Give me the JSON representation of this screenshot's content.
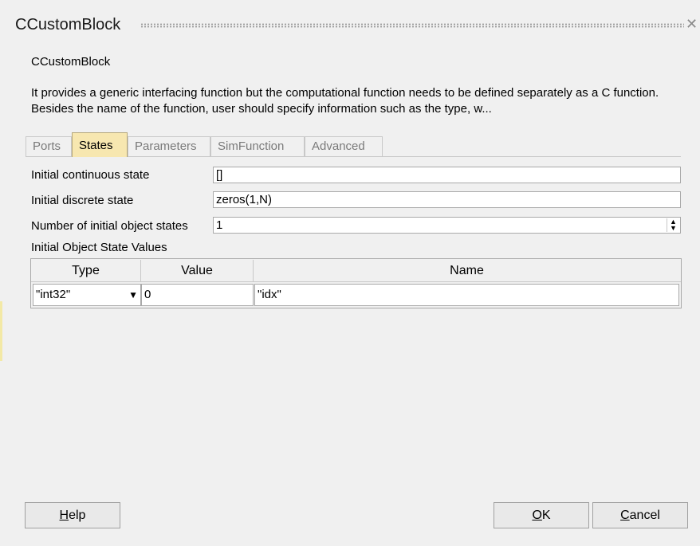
{
  "window": {
    "title": "CCustomBlock"
  },
  "block_name": "CCustomBlock",
  "description": "It provides a generic interfacing function but the computational function needs to be defined separately as a C function. Besides the name of the function, user should specify information such as the type, w...",
  "tabs": [
    {
      "label": "Ports",
      "active": false
    },
    {
      "label": "States",
      "active": true
    },
    {
      "label": "Parameters",
      "active": false
    },
    {
      "label": "SimFunction",
      "active": false
    },
    {
      "label": "Advanced",
      "active": false
    }
  ],
  "states": {
    "initial_continuous_label": "Initial continuous state",
    "initial_continuous_value": "[]",
    "initial_discrete_label": "Initial discrete state",
    "initial_discrete_value": "zeros(1,N)",
    "num_object_states_label": "Number of initial object states",
    "num_object_states_value": "1",
    "object_values_label": "Initial Object State Values"
  },
  "table": {
    "headers": [
      "Type",
      "Value",
      "Name"
    ],
    "rows": [
      {
        "type": "\"int32\"",
        "value": "0",
        "name": "\"idx\""
      }
    ]
  },
  "buttons": {
    "help_prefix": "",
    "help_ul": "H",
    "help_rest": "elp",
    "ok_ul": "O",
    "ok_rest": "K",
    "cancel_ul": "C",
    "cancel_rest": "ancel"
  },
  "icons": {
    "close": "close-icon",
    "dropdown": "chevron-down-icon",
    "spin": "spin-updown-icon"
  },
  "colors": {
    "active_tab": "#f7e7b0",
    "background": "#f0f0f0"
  }
}
